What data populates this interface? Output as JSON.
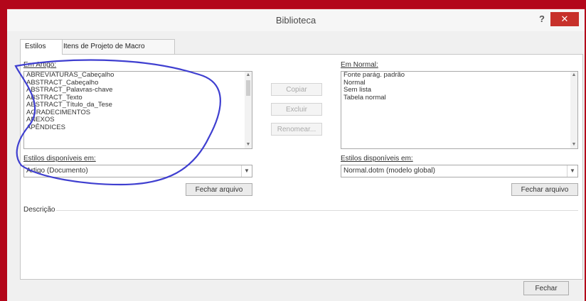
{
  "window": {
    "title": "Biblioteca",
    "help": "?",
    "close": "✕"
  },
  "tabs": [
    {
      "label": "Estilos"
    },
    {
      "label": "Itens de Projeto de Macro"
    }
  ],
  "left": {
    "label": "Em Artigo:",
    "items": [
      "ABREVIATURAS_Cabeçalho",
      "ABSTRACT_Cabeçalho",
      "ABSTRACT_Palavras-chave",
      "ABSTRACT_Texto",
      "ABSTRACT_Título_da_Tese",
      "AGRADECIMENTOS",
      "ANEXOS",
      "APÊNDICES"
    ],
    "available_label": "Estilos disponíveis em:",
    "available_value": "Artigo (Documento)",
    "close_file": "Fechar arquivo"
  },
  "buttons": {
    "copy": "Copiar",
    "delete": "Excluir",
    "rename": "Renomear..."
  },
  "right": {
    "label": "Em Normal:",
    "items": [
      "Fonte parág. padrão",
      "Normal",
      "Sem lista",
      "Tabela normal"
    ],
    "available_label": "Estilos disponíveis em:",
    "available_value": "Normal.dotm (modelo global)",
    "close_file": "Fechar arquivo"
  },
  "description_label": "Descrição",
  "footer": {
    "close": "Fechar"
  },
  "colors": {
    "frame": "#b3061a",
    "close_button": "#c7312b",
    "annotation": "#3f3fd0"
  },
  "icons": {
    "scroll_up": "▲",
    "scroll_down": "▼",
    "dropdown": "▼"
  }
}
